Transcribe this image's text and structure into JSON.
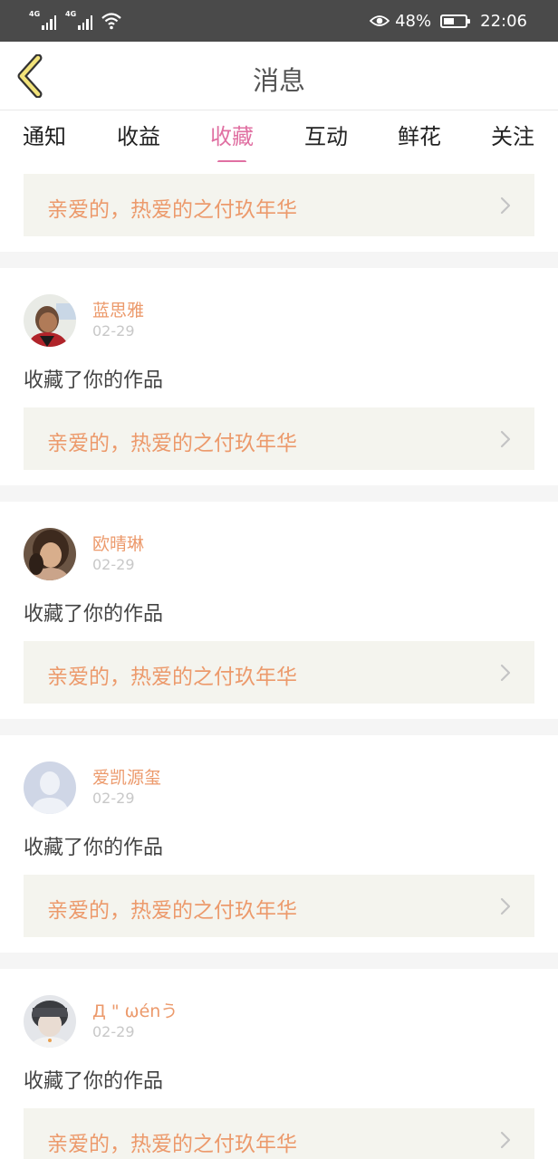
{
  "status_bar": {
    "signal1_label": "4G",
    "signal2_label": "4G",
    "eye_icon": "eye-icon",
    "battery_text": "48%",
    "battery_level": 0.48,
    "time": "22:06"
  },
  "header": {
    "title": "消息",
    "back_icon": "chevron-left-icon"
  },
  "tabs": [
    {
      "label": "通知",
      "active": false
    },
    {
      "label": "收益",
      "active": false
    },
    {
      "label": "收藏",
      "active": true
    },
    {
      "label": "互动",
      "active": false
    },
    {
      "label": "鲜花",
      "active": false
    },
    {
      "label": "关注",
      "active": false
    }
  ],
  "first_item": {
    "work_title": "亲爱的，热爱的之付玖年华"
  },
  "messages": [
    {
      "username": "蓝思雅",
      "date": "02-29",
      "text": "收藏了你的作品",
      "work_title": "亲爱的，热爱的之付玖年华",
      "avatar": "photo-girl-red"
    },
    {
      "username": "欧晴琳",
      "date": "02-29",
      "text": "收藏了你的作品",
      "work_title": "亲爱的，热爱的之付玖年华",
      "avatar": "photo-girl-brown"
    },
    {
      "username": "爱凯源玺",
      "date": "02-29",
      "text": "收藏了你的作品",
      "work_title": "亲爱的，热爱的之付玖年华",
      "avatar": "default-avatar-icon"
    },
    {
      "username": "Д \" ωénう",
      "date": "02-29",
      "text": "收藏了你的作品",
      "work_title": "亲爱的，热爱的之付玖年华",
      "avatar": "photo-boy-gray"
    }
  ],
  "colors": {
    "accent": "#e070a2",
    "username": "#ec9a6c",
    "work_title": "#ec9a6c",
    "status_bar_bg": "#4a4a4a"
  }
}
